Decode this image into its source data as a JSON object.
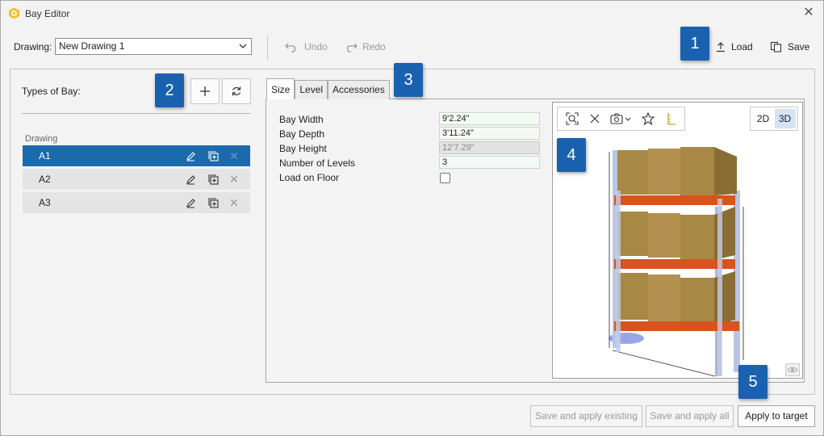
{
  "window": {
    "title": "Bay Editor"
  },
  "toolbar": {
    "drawing_label": "Drawing:",
    "drawing_value": "New Drawing 1",
    "undo_label": "Undo",
    "redo_label": "Redo",
    "load_label": "Load",
    "save_label": "Save"
  },
  "badges": [
    "1",
    "2",
    "3",
    "4",
    "5"
  ],
  "bay_types": {
    "heading": "Types of Bay:",
    "group_label": "Drawing",
    "items": [
      {
        "label": "A1",
        "selected": true
      },
      {
        "label": "A2",
        "selected": false
      },
      {
        "label": "A3",
        "selected": false
      }
    ]
  },
  "tabs": [
    "Size",
    "Level",
    "Accessories"
  ],
  "active_tab": "Size",
  "size": {
    "bay_width_label": "Bay Width",
    "bay_width_value": "9'2.24\"",
    "bay_depth_label": "Bay Depth",
    "bay_depth_value": "3'11.24\"",
    "bay_height_label": "Bay Height",
    "bay_height_value": "12'7.29\"",
    "num_levels_label": "Number of Levels",
    "num_levels_value": "3",
    "load_on_floor_label": "Load on Floor",
    "load_on_floor_checked": false
  },
  "viewer": {
    "mode_2d": "2D",
    "mode_3d": "3D",
    "active_mode": "3D"
  },
  "footer": {
    "save_existing_label": "Save and apply existing",
    "save_all_label": "Save and apply all",
    "apply_target_label": "Apply to target"
  },
  "colors": {
    "accent": "#1b6aac",
    "badge": "#1a61b0",
    "beam": "#d9531e",
    "box": "#a88845",
    "upright": "#a9b8d8"
  }
}
